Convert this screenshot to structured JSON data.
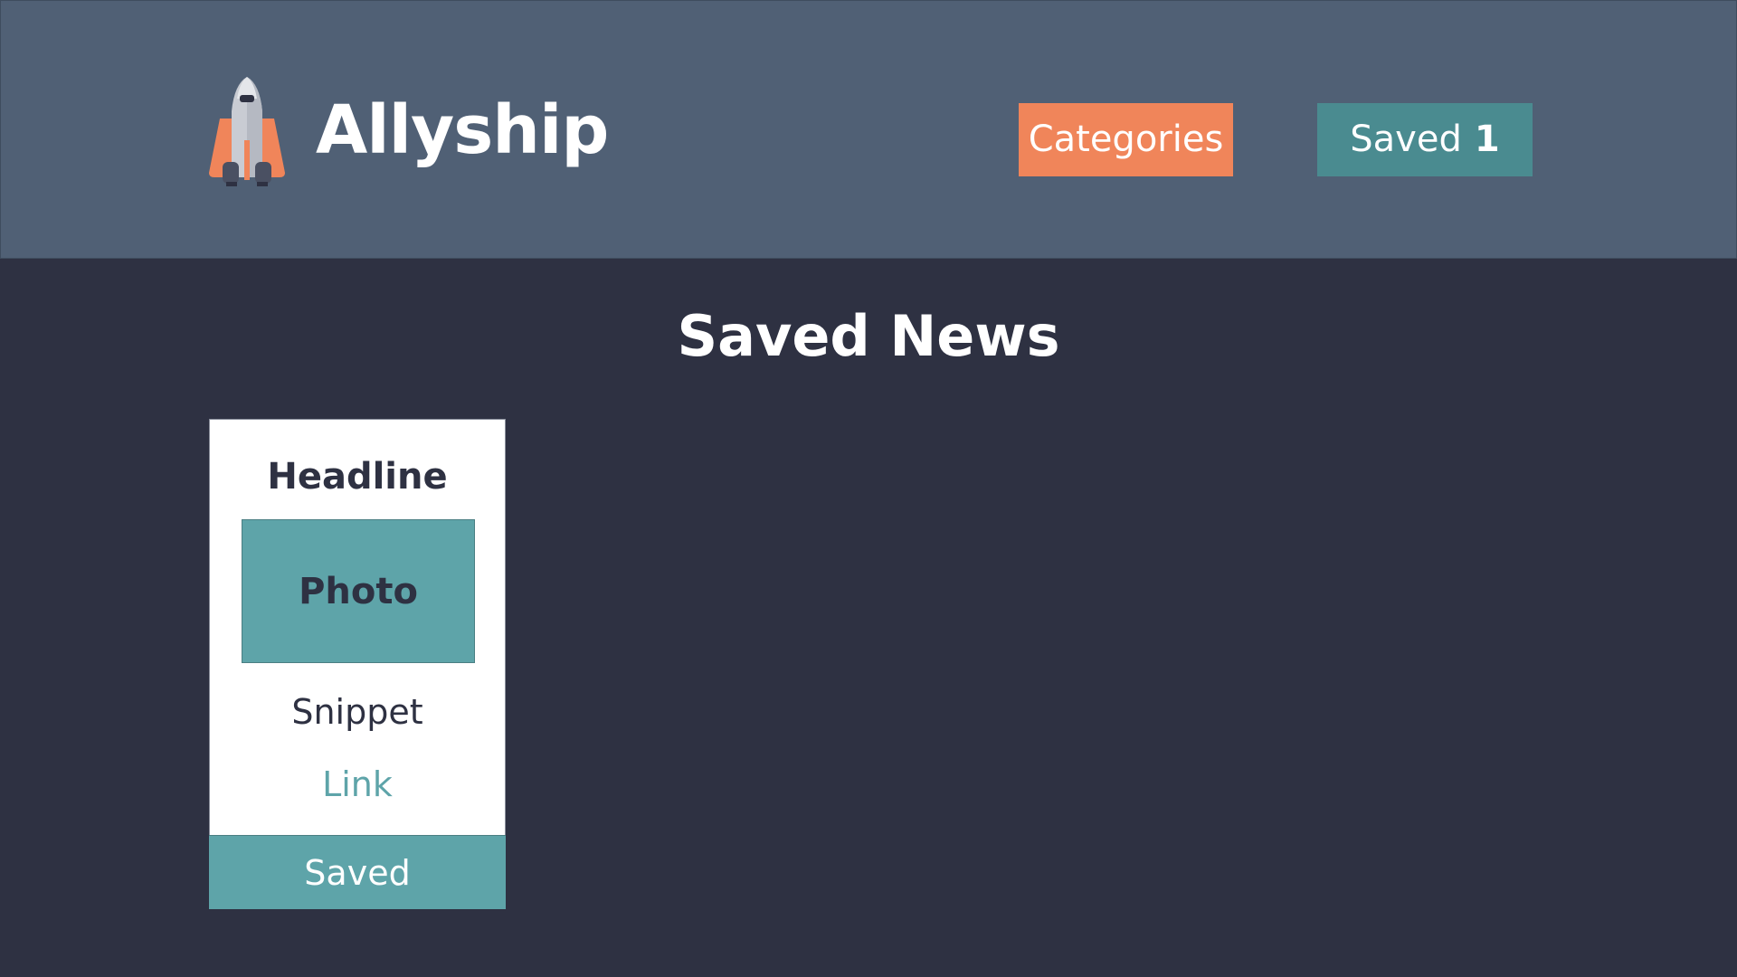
{
  "header": {
    "brand_name": "Allyship",
    "logo_icon": "rocket-shuttle-icon",
    "categories_label": "Categories",
    "saved_label": "Saved",
    "saved_count": "1"
  },
  "main": {
    "title": "Saved News",
    "cards": [
      {
        "headline": "Headline",
        "photo_label": "Photo",
        "snippet": "Snippet",
        "link_label": "Link",
        "saved_button_label": "Saved"
      }
    ]
  },
  "colors": {
    "header_bg": "#506075",
    "page_bg": "#2e3142",
    "accent_orange": "#f0855a",
    "accent_teal": "#4a8b90",
    "card_teal": "#5ea4a9",
    "text_dark": "#2e3142"
  }
}
